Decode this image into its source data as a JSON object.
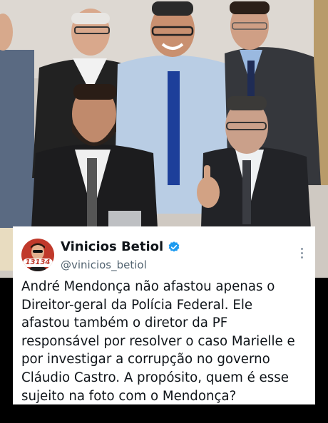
{
  "tweet": {
    "display_name": "Vinicios Betiol",
    "handle": "@vinicios_betiol",
    "avatar_badge": "13134",
    "text": "André Mendonça não afastou apenas o\nDireitor-geral da Polícia Federal. Ele\nafastou também o diretor da PF\nresponsável por resolver o caso Marielle e\npor investigar a corrupção no governo\nCláudio Castro. A propósito, quem é esse\nsujeito na foto com o Mendonça?",
    "verified": true
  },
  "icons": {
    "verified": "verified-badge-icon",
    "more": "more-options-icon"
  },
  "colors": {
    "verified_blue": "#1d9bf0",
    "avatar_red": "#c0392b",
    "text": "#0f1419",
    "secondary_text": "#536471"
  }
}
